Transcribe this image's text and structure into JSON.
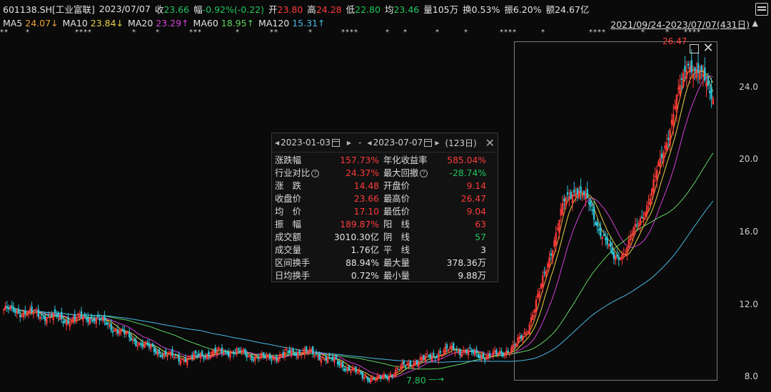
{
  "header": {
    "code": "601138.SH[工业富联]",
    "date": "2023/07/07",
    "close_label": "收",
    "close_value": "23.66",
    "change_label": "幅",
    "change_value": "-0.92%(-0.22)",
    "open_label": "开",
    "open_value": "23.80",
    "high_label": "高",
    "high_value": "24.28",
    "low_label": "低",
    "low_value": "22.80",
    "avg_label": "均",
    "avg_value": "23.46",
    "volume_label": "量",
    "volume_value": "105万",
    "turnover_label": "换",
    "turnover_value": "0.53%",
    "amplitude_label": "振",
    "amplitude_value": "6.20%",
    "amount_label": "额",
    "amount_value": "24.67亿"
  },
  "ma": [
    {
      "label": "MA5",
      "value": "24.07↓",
      "color": "#f0a032"
    },
    {
      "label": "MA10",
      "value": "23.84↓",
      "color": "#e8d246"
    },
    {
      "label": "MA20",
      "value": "23.29↑",
      "color": "#d33fd3"
    },
    {
      "label": "MA60",
      "value": "18.95↑",
      "color": "#5fd35f"
    },
    {
      "label": "MA120",
      "value": "15.31↑",
      "color": "#4ab8e6"
    }
  ],
  "range_link": "2021/09/24-2023/07/07(431日)",
  "y_ticks": [
    "24.0",
    "20.0",
    "16.0",
    "12.0",
    "8.0"
  ],
  "selection": {
    "peak_label": "26.47",
    "low_label": "7.80"
  },
  "panel": {
    "start_date": "2023-01-03",
    "end_date": "2023-07-07",
    "dash": "-",
    "days": "(123日)",
    "rows": [
      {
        "l1": "涨跌幅",
        "v1": "157.73%",
        "c1": "up",
        "l2": "年化收益率",
        "v2": "585.04%",
        "c2": "up"
      },
      {
        "l1": "行业对比",
        "v1": "24.37%",
        "c1": "up",
        "l2": "最大回撤",
        "v2": "-28.74%",
        "c2": "down",
        "q1": true,
        "q2": true
      },
      {
        "l1": "涨　跌",
        "v1": "14.48",
        "c1": "up",
        "l2": "开盘价",
        "v2": "9.14",
        "c2": "up"
      },
      {
        "l1": "收盘价",
        "v1": "23.66",
        "c1": "up",
        "l2": "最高价",
        "v2": "26.47",
        "c2": "up"
      },
      {
        "l1": "均　价",
        "v1": "17.10",
        "c1": "up",
        "l2": "最低价",
        "v2": "9.04",
        "c2": "up"
      },
      {
        "l1": "振　幅",
        "v1": "189.87%",
        "c1": "up",
        "l2": "阳　线",
        "v2": "63",
        "c2": "up"
      },
      {
        "l1": "成交额",
        "v1": "3010.30亿",
        "c1": "wht",
        "l2": "阴　线",
        "v2": "57",
        "c2": "down"
      },
      {
        "l1": "成交量",
        "v1": "1.76亿",
        "c1": "wht",
        "l2": "平　线",
        "v2": "3",
        "c2": "wht"
      },
      {
        "l1": "区间换手",
        "v1": "88.94%",
        "c1": "wht",
        "l2": "最大量",
        "v2": "378.36万",
        "c2": "wht"
      },
      {
        "l1": "日均换手",
        "v1": "0.72%",
        "c1": "wht",
        "l2": "最小量",
        "v2": "9.88万",
        "c2": "wht"
      }
    ]
  },
  "colors": {
    "up": "#ff3b3b",
    "down": "#22c55e",
    "ma5": "#f0a032",
    "ma10": "#e8d246",
    "ma20": "#d33fd3",
    "ma60": "#5fd35f",
    "ma120": "#4ab8e6"
  },
  "chart_data": {
    "type": "line",
    "y_range": [
      7.8,
      26.47
    ],
    "y_ticks": [
      24.0,
      20.0,
      16.0,
      12.0,
      8.0
    ],
    "price_path": [
      11.7,
      11.6,
      11.5,
      11.4,
      11.3,
      11.1,
      11.2,
      11.3,
      11.0,
      10.6,
      10.2,
      9.8,
      9.5,
      9.2,
      9.0,
      9.0,
      9.2,
      9.3,
      9.4,
      9.3,
      9.1,
      9.0,
      9.1,
      9.3,
      9.4,
      9.2,
      9.0,
      8.7,
      8.3,
      8.0,
      7.8,
      8.1,
      8.5,
      8.8,
      9.0,
      9.3,
      9.5,
      9.4,
      9.2,
      9.1,
      9.3,
      9.6,
      10.5,
      12.5,
      15.0,
      17.5,
      18.5,
      17.5,
      16.0,
      14.5,
      15.0,
      16.5,
      18.0,
      20.5,
      23.0,
      25.5,
      24.5,
      23.66
    ]
  }
}
